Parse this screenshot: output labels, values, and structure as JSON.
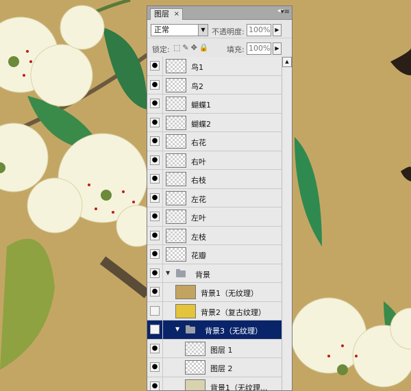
{
  "panel": {
    "tab_label": "图层",
    "close_glyph": "×",
    "collapse_glyph": "◂◂",
    "menu_glyph": "▾≡"
  },
  "options": {
    "blend_mode": "正常",
    "opacity_label": "不透明度:",
    "opacity_value": "100%",
    "lock_label": "锁定:",
    "lock_icons": "⬚✎✥🔒",
    "fill_label": "填充:",
    "fill_value": "100%"
  },
  "layers": [
    {
      "name": "鸟1",
      "visible": true,
      "type": "layer",
      "indent": 0
    },
    {
      "name": "鸟2",
      "visible": true,
      "type": "layer",
      "indent": 0
    },
    {
      "name": "蝴蝶1",
      "visible": true,
      "type": "layer",
      "indent": 0
    },
    {
      "name": "蝴蝶2",
      "visible": true,
      "type": "layer",
      "indent": 0
    },
    {
      "name": "右花",
      "visible": true,
      "type": "layer",
      "indent": 0
    },
    {
      "name": "右叶",
      "visible": true,
      "type": "layer",
      "indent": 0
    },
    {
      "name": "右枝",
      "visible": true,
      "type": "layer",
      "indent": 0
    },
    {
      "name": "左花",
      "visible": true,
      "type": "layer",
      "indent": 0
    },
    {
      "name": "左叶",
      "visible": true,
      "type": "layer",
      "indent": 0
    },
    {
      "name": "左枝",
      "visible": true,
      "type": "layer",
      "indent": 0
    },
    {
      "name": "花瓣",
      "visible": true,
      "type": "layer",
      "indent": 0
    },
    {
      "name": "背景",
      "visible": true,
      "type": "group",
      "indent": 0
    },
    {
      "name": "背景1（无纹理）",
      "visible": true,
      "type": "layer",
      "indent": 1,
      "thumb_color": "#c2a460"
    },
    {
      "name": "背景2（复古纹理）",
      "visible": false,
      "type": "layer",
      "indent": 1,
      "thumb_color": "#e3c43b"
    },
    {
      "name": "背景3（无纹理）",
      "visible": false,
      "type": "group",
      "indent": 1,
      "selected": true
    },
    {
      "name": "图层 1",
      "visible": true,
      "type": "layer",
      "indent": 2
    },
    {
      "name": "图层 2",
      "visible": true,
      "type": "layer",
      "indent": 2
    },
    {
      "name": "背景1（无纹理...",
      "visible": true,
      "type": "layer",
      "indent": 2,
      "thumb_color": "#d9d2ae"
    }
  ],
  "colors": {
    "canvas_bg": "#c4a664",
    "selection": "#0a246a"
  }
}
